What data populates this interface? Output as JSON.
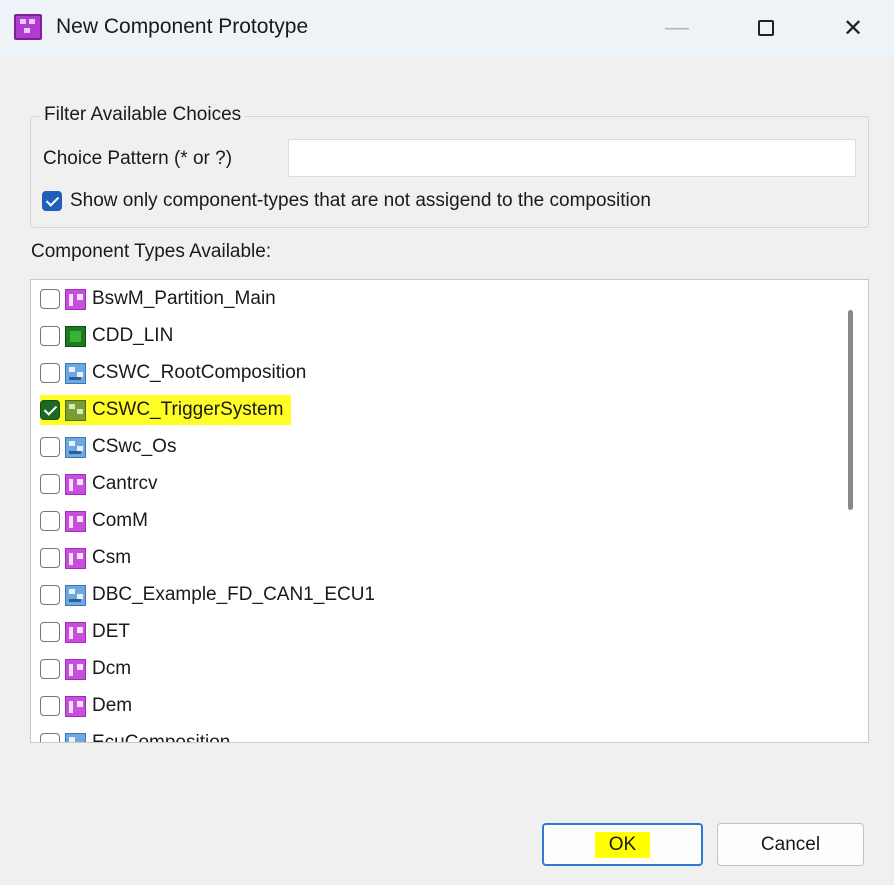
{
  "window": {
    "title": "New Component Prototype",
    "minimize_label": "—",
    "close_label": "✕"
  },
  "filter": {
    "legend": "Filter Available Choices",
    "pattern_label": "Choice Pattern (* or ?)",
    "pattern_value": "",
    "show_only_label": "Show only component-types that are not assigend to the composition",
    "show_only_checked": true
  },
  "list": {
    "label": "Component Types Available:",
    "items": [
      {
        "label": "BswM_Partition_Main",
        "icon": "bsw-module-icon",
        "checked": false
      },
      {
        "label": "CDD_LIN",
        "icon": "cdd-icon",
        "checked": false
      },
      {
        "label": "CSWC_RootComposition",
        "icon": "composition-icon",
        "checked": false
      },
      {
        "label": "CSWC_TriggerSystem",
        "icon": "application-swc-icon",
        "checked": true,
        "highlighted": true
      },
      {
        "label": "CSwc_Os",
        "icon": "composition-icon",
        "checked": false
      },
      {
        "label": "Cantrcv",
        "icon": "bsw-module-icon",
        "checked": false
      },
      {
        "label": "ComM",
        "icon": "bsw-module-icon",
        "checked": false
      },
      {
        "label": "Csm",
        "icon": "bsw-module-icon",
        "checked": false
      },
      {
        "label": "DBC_Example_FD_CAN1_ECU1",
        "icon": "composition-icon",
        "checked": false
      },
      {
        "label": "DET",
        "icon": "bsw-module-icon",
        "checked": false
      },
      {
        "label": "Dcm",
        "icon": "bsw-module-icon",
        "checked": false
      },
      {
        "label": "Dem",
        "icon": "bsw-module-icon",
        "checked": false
      },
      {
        "label": "EcuComposition",
        "icon": "composition-icon",
        "checked": false
      }
    ]
  },
  "buttons": {
    "ok": "OK",
    "cancel": "Cancel"
  }
}
